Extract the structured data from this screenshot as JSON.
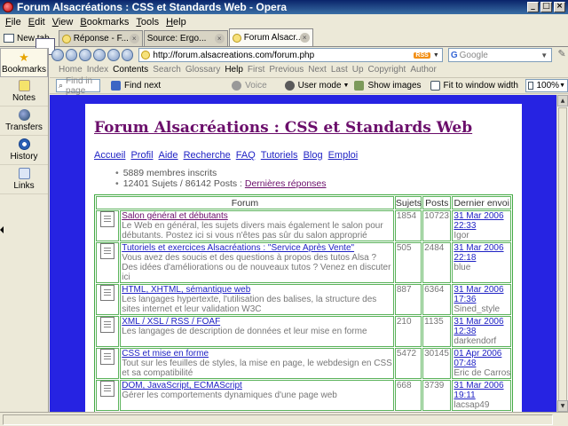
{
  "window": {
    "title": "Forum Alsacréations : CSS et Standards Web - Opera"
  },
  "menu": [
    {
      "label": "File",
      "u": "F",
      "rest": "ile"
    },
    {
      "label": "Edit",
      "u": "E",
      "rest": "dit"
    },
    {
      "label": "View",
      "u": "V",
      "rest": "iew"
    },
    {
      "label": "Bookmarks",
      "u": "B",
      "rest": "ookmarks"
    },
    {
      "label": "Tools",
      "u": "T",
      "rest": "ools"
    },
    {
      "label": "Help",
      "u": "H",
      "rest": "elp"
    }
  ],
  "tabs": {
    "new_tab_label": "New tab",
    "items": [
      {
        "label": "Réponse - F...",
        "active": false,
        "icon": "favicon"
      },
      {
        "label": "Source: Ergo...",
        "active": false,
        "icon": "page"
      },
      {
        "label": "Forum Alsacr...",
        "active": true,
        "icon": "favicon"
      }
    ]
  },
  "sidepanel": [
    {
      "label": "Bookmarks",
      "icon": "star-icon",
      "active": true
    },
    {
      "label": "Notes",
      "icon": "notes-icon",
      "active": false
    },
    {
      "label": "Transfers",
      "icon": "transfers-icon",
      "active": false
    },
    {
      "label": "History",
      "icon": "history-icon",
      "active": false
    },
    {
      "label": "Links",
      "icon": "links-icon",
      "active": false
    }
  ],
  "address": {
    "url": "http://forum.alsacreations.com/forum.php",
    "rss": "RSS"
  },
  "search": {
    "engine_letter": "G",
    "placeholder": "Google"
  },
  "navlinks": [
    {
      "label": "Home",
      "on": false
    },
    {
      "label": "Index",
      "on": false
    },
    {
      "label": "Contents",
      "on": true
    },
    {
      "label": "Search",
      "on": false
    },
    {
      "label": "Glossary",
      "on": false
    },
    {
      "label": "Help",
      "on": true
    },
    {
      "label": "First",
      "on": false
    },
    {
      "label": "Previous",
      "on": false
    },
    {
      "label": "Next",
      "on": false
    },
    {
      "label": "Last",
      "on": false
    },
    {
      "label": "Up",
      "on": false
    },
    {
      "label": "Copyright",
      "on": false
    },
    {
      "label": "Author",
      "on": false
    }
  ],
  "toolbar": {
    "find_placeholder": "Find in page",
    "find_next": "Find next",
    "voice": "Voice",
    "user_mode": "User mode",
    "show_images": "Show images",
    "fit_to_window": "Fit to window width",
    "zoom": "100%"
  },
  "page": {
    "site_title": "Forum Alsacréations : CSS et Standards Web",
    "nav": [
      "Accueil",
      "Profil",
      "Aide",
      "Recherche",
      "FAQ",
      "Tutoriels",
      "Blog",
      "Emploi"
    ],
    "stats": {
      "members": "5889 membres inscrits",
      "topics_posts": "12401 Sujets / 86142 Posts :",
      "latest_link": "Dernières réponses"
    },
    "table": {
      "headers": {
        "forum": "Forum",
        "topics": "Sujets",
        "posts": "Posts",
        "last": "Dernier envoi"
      },
      "rows": [
        {
          "name": "Salon général et débutants",
          "visited": true,
          "desc": "Le Web en général, les sujets divers mais également le salon pour débutants. Postez ici si vous n'êtes pas sûr du salon approprié",
          "topics": "1854",
          "posts": "10723",
          "last_date": "31 Mar 2006",
          "last_time": "22:33",
          "last_user": "Igor"
        },
        {
          "name": "Tutoriels et exercices Alsacréations : \"Service Après Vente\"",
          "visited": false,
          "desc": "Vous avez des soucis et des questions à propos des tutos Alsa ? Des idées d'améliorations ou de nouveaux tutos ? Venez en discuter ici",
          "topics": "505",
          "posts": "2484",
          "last_date": "31 Mar 2006",
          "last_time": "22:18",
          "last_user": "blue"
        },
        {
          "name": "HTML, XHTML, sémantique web",
          "visited": false,
          "desc": "Les langages hypertexte, l'utilisation des balises, la structure des sites internet et leur validation W3C",
          "topics": "887",
          "posts": "6364",
          "last_date": "31 Mar 2006",
          "last_time": "17:36",
          "last_user": "Sined_style"
        },
        {
          "name": "XML / XSL / RSS / FOAF",
          "visited": false,
          "desc": "Les langages de description de données et leur mise en forme",
          "topics": "210",
          "posts": "1135",
          "last_date": "31 Mar 2006",
          "last_time": "12:38",
          "last_user": "darkendorf"
        },
        {
          "name": "CSS et mise en forme",
          "visited": false,
          "desc": "Tout sur les feuilles de styles, la mise en page, le webdesign en CSS et sa compatibilité",
          "topics": "5472",
          "posts": "30145",
          "last_date": "01 Apr 2006",
          "last_time": "07:48",
          "last_user": "Eric de Carros"
        },
        {
          "name": "DOM, JavaScript, ECMAScript",
          "visited": false,
          "desc": "Gérer les comportements dynamiques d'une page web",
          "topics": "668",
          "posts": "3739",
          "last_date": "31 Mar 2006",
          "last_time": "19:11",
          "last_user": "lacsap49"
        }
      ]
    }
  }
}
